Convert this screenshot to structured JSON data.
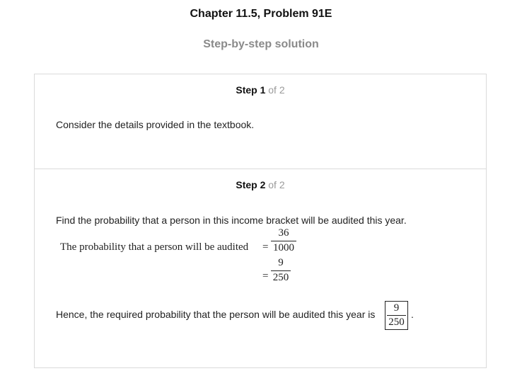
{
  "header": {
    "chapter_title": "Chapter 11.5, Problem 91E",
    "subtitle": "Step-by-step solution"
  },
  "steps": [
    {
      "label": "Step 1",
      "of": "of 2",
      "text": "Consider the details provided in the textbook."
    },
    {
      "label": "Step 2",
      "of": "of 2",
      "text": "Find the probability that a person in this income bracket will be audited this year.",
      "equation_label": "The probability that a person will be audited",
      "eq_sign": "=",
      "frac1": {
        "num": "36",
        "den": "1000"
      },
      "frac2": {
        "num": "9",
        "den": "250"
      },
      "conclusion": "Hence, the required probability that the person will be audited this year is",
      "answer": {
        "num": "9",
        "den": "250"
      },
      "period": "."
    }
  ]
}
